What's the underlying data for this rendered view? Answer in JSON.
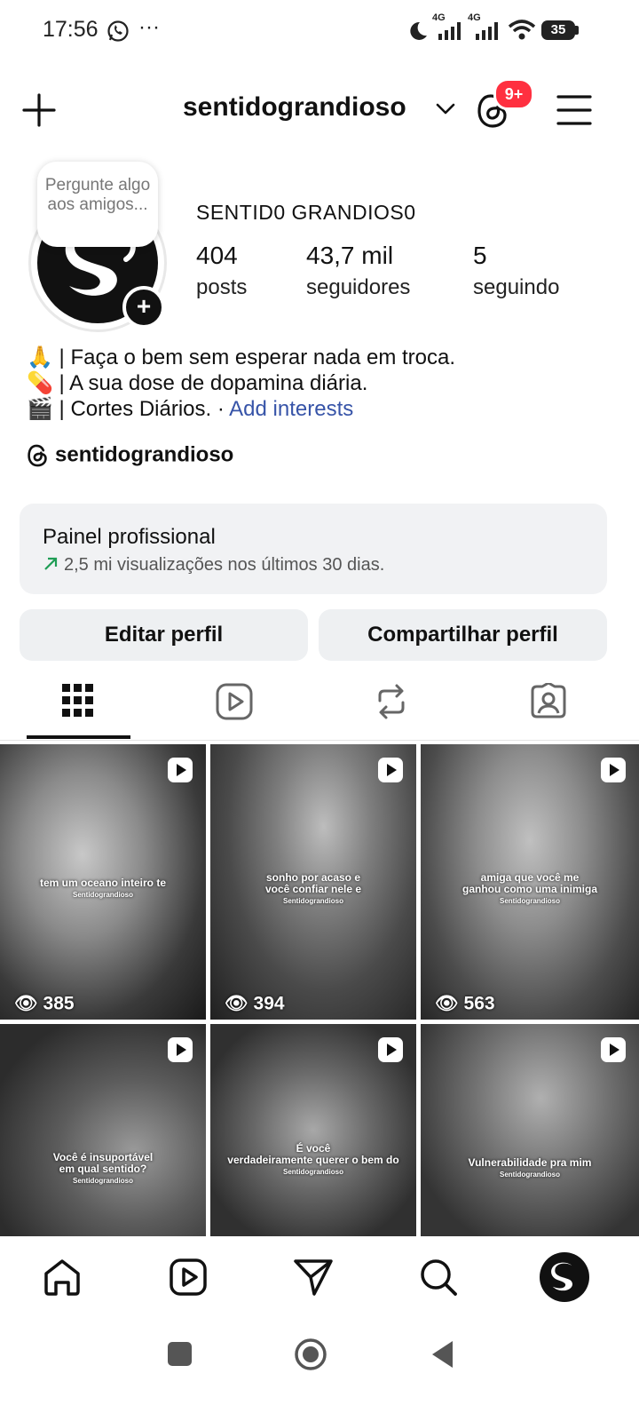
{
  "status_bar": {
    "time": "17:56",
    "more": "···",
    "net1": "4G",
    "net2": "4G",
    "battery": "35"
  },
  "header": {
    "username": "sentidograndioso",
    "notification_badge": "9+"
  },
  "profile": {
    "note": "Pergunte algo aos amigos...",
    "display_name": "SENTID0 GRANDIOS0",
    "stats": [
      {
        "value": "404",
        "label": "posts"
      },
      {
        "value": "43,7 mil",
        "label": "seguidores"
      },
      {
        "value": "5",
        "label": "seguindo"
      }
    ],
    "bio": [
      {
        "emoji": "🙏",
        "text": " | Faça o bem sem esperar nada em troca."
      },
      {
        "emoji": "💊",
        "text": " | A sua dose de dopamina diária."
      },
      {
        "emoji": "🎬",
        "text": " | Cortes Diários. · ",
        "link": "Add interests"
      }
    ],
    "threads_handle": "sentidograndioso"
  },
  "dashboard": {
    "title": "Painel profissional",
    "subtitle": "2,5 mi visualizações nos últimos 30 dias.",
    "trend_color": "#1f9d55"
  },
  "actions": {
    "edit": "Editar perfil",
    "share": "Compartilhar perfil"
  },
  "tabs": [
    "grid",
    "reels",
    "reposts",
    "tagged"
  ],
  "grid": [
    {
      "caption": "tem um oceano inteiro te",
      "sub": "Sentidograndioso",
      "views": "385"
    },
    {
      "caption": "sonho por acaso e\nvocê confiar nele e",
      "sub": "Sentidograndioso",
      "views": "394"
    },
    {
      "caption": "amiga que você me\nganhou como uma inimiga",
      "sub": "Sentidograndioso",
      "views": "563"
    },
    {
      "caption": "Você é insuportável\nem qual sentido?",
      "sub": "Sentidograndioso",
      "views": ""
    },
    {
      "caption": "É você\nverdadeiramente querer o bem do",
      "sub": "Sentidograndioso",
      "views": ""
    },
    {
      "caption": "Vulnerabilidade pra mim",
      "sub": "Sentidograndioso",
      "views": ""
    }
  ]
}
